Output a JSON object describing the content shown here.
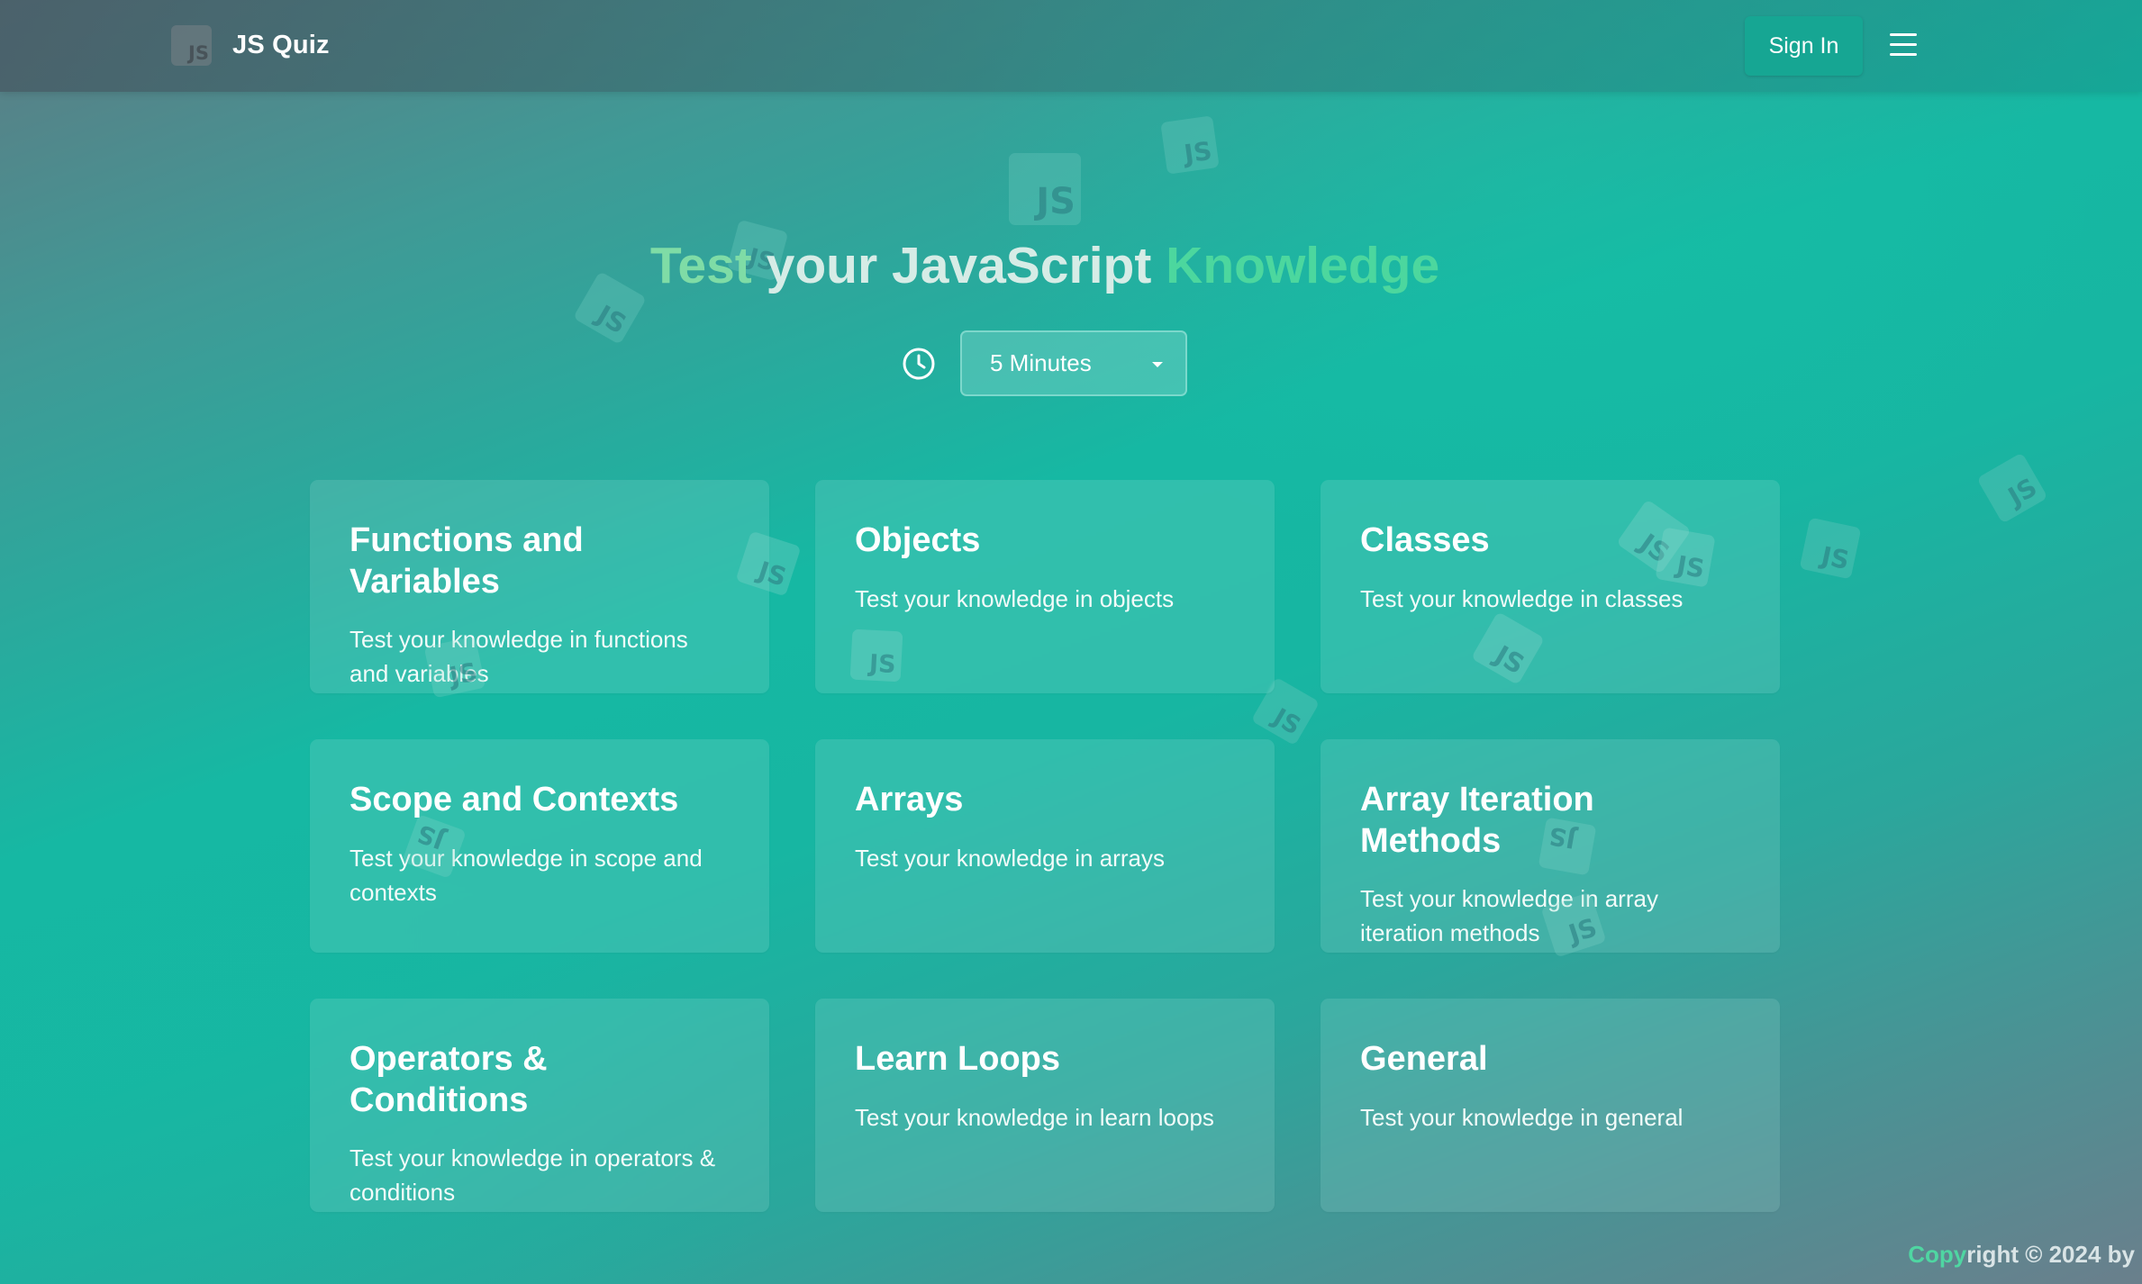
{
  "header": {
    "logo_text": "JS",
    "brand": "JS Quiz",
    "signin_label": "Sign In",
    "menu_icon": "hamburger-menu-icon"
  },
  "hero": {
    "title_part1": "Test",
    "title_part2": " your JavaScript ",
    "title_part3": "Knowledge",
    "timer_icon": "clock-icon",
    "timer_selected": "5 Minutes"
  },
  "decor": {
    "badge_text": "JS"
  },
  "cards": [
    {
      "title": "Functions and Variables",
      "description": "Test your knowledge in functions and variables"
    },
    {
      "title": "Objects",
      "description": "Test your knowledge in objects"
    },
    {
      "title": "Classes",
      "description": "Test your knowledge in classes"
    },
    {
      "title": "Scope and Contexts",
      "description": "Test your knowledge in scope and contexts"
    },
    {
      "title": "Arrays",
      "description": "Test your knowledge in arrays"
    },
    {
      "title": "Array Iteration Methods",
      "description": "Test your knowledge in array iteration methods"
    },
    {
      "title": "Operators & Conditions",
      "description": "Test your knowledge in operators & conditions"
    },
    {
      "title": "Learn Loops",
      "description": "Test your knowledge in learn loops"
    },
    {
      "title": "General",
      "description": "Test your knowledge in general"
    }
  ],
  "footer": {
    "copy_accent": "Copy",
    "copy_rest": "right © 2024 by"
  },
  "colors": {
    "accent_green": "#4cd79e",
    "button_teal": "#16a693",
    "background_teal": "#17b6a2"
  }
}
